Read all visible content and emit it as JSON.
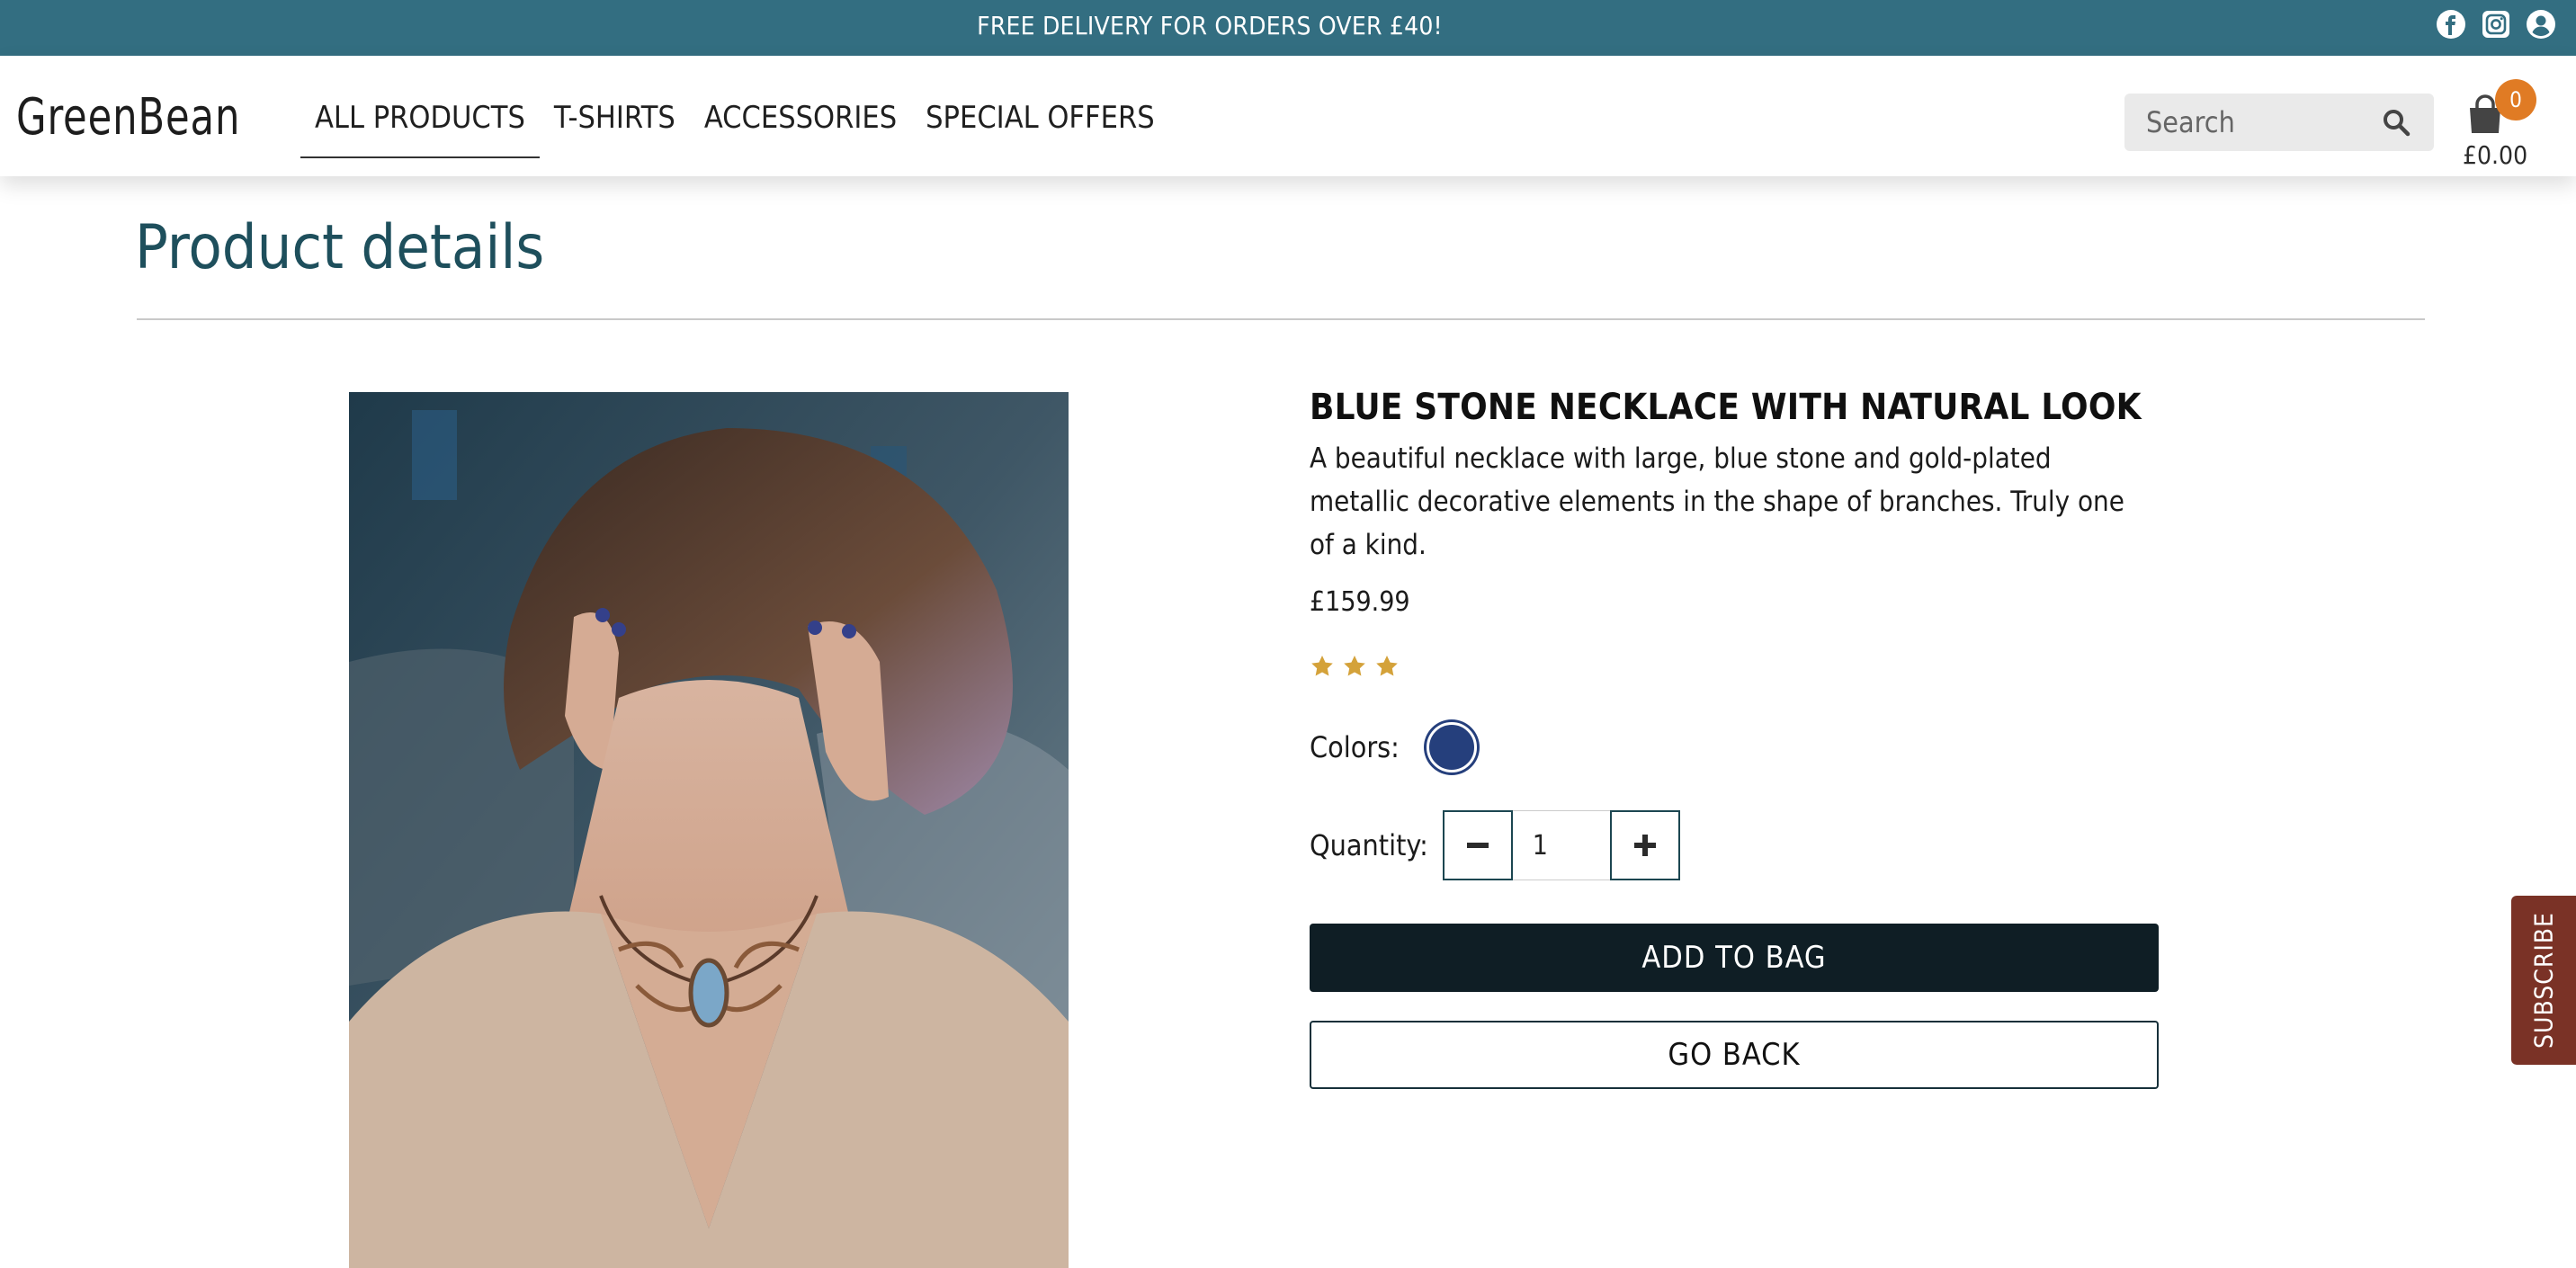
{
  "topbar": {
    "message": "FREE DELIVERY FOR ORDERS OVER £40!",
    "icons": [
      "facebook-icon",
      "instagram-icon",
      "user-account-icon"
    ]
  },
  "header": {
    "logo": "GreenBean",
    "nav": [
      {
        "label": "ALL PRODUCTS",
        "active": true
      },
      {
        "label": "T-SHIRTS"
      },
      {
        "label": "ACCESSORIES"
      },
      {
        "label": "SPECIAL OFFERS"
      }
    ],
    "search_placeholder": "Search",
    "cart": {
      "count": "0",
      "total": "£0.00"
    }
  },
  "page": {
    "title": "Product details"
  },
  "product": {
    "name": "BLUE STONE NECKLACE WITH NATURAL LOOK",
    "description": "A beautiful necklace with large, blue stone and gold-plated metallic decorative elements in the shape of branches. Truly one of a kind.",
    "price": "£159.99",
    "rating": 3,
    "colors_label": "Colors:",
    "colors": [
      "#253f7c"
    ],
    "quantity_label": "Quantity:",
    "quantity": "1",
    "add_label": "ADD TO BAG",
    "back_label": "GO BACK"
  },
  "subscribe": {
    "label": "SUBSCRIBE"
  },
  "colors": {
    "topbar": "#336e81",
    "title": "#1e4f5c",
    "badge": "#e07b24",
    "star": "#d4a23a",
    "primary_button": "#0f1e25",
    "subscribe": "#7a3226"
  }
}
